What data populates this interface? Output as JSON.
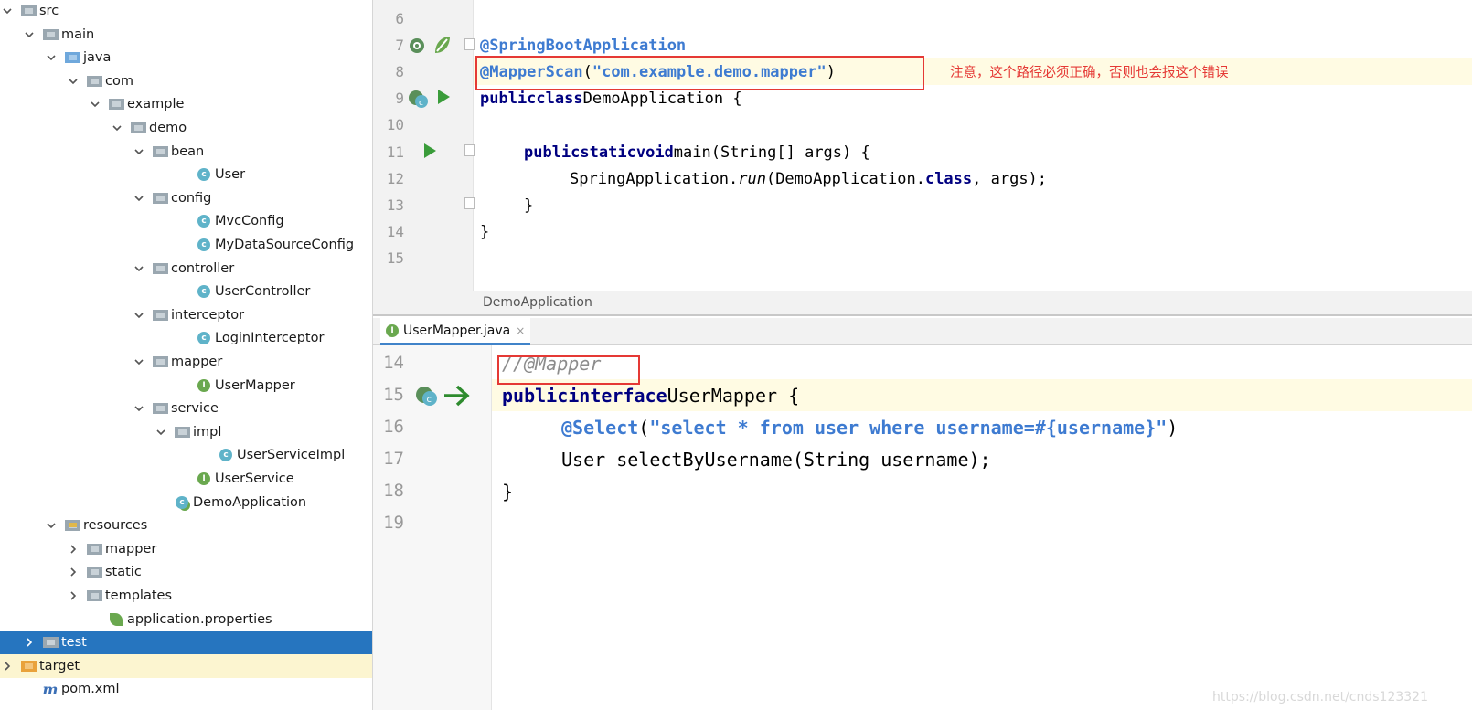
{
  "tree": {
    "items": [
      {
        "label": "src",
        "icon": "folder",
        "expanded": true
      },
      {
        "label": "main",
        "icon": "folder",
        "expanded": true
      },
      {
        "label": "java",
        "icon": "folder-blue",
        "expanded": true
      },
      {
        "label": "com",
        "icon": "package",
        "expanded": true
      },
      {
        "label": "example",
        "icon": "package",
        "expanded": true
      },
      {
        "label": "demo",
        "icon": "package",
        "expanded": true
      },
      {
        "label": "bean",
        "icon": "package",
        "expanded": true
      },
      {
        "label": "User",
        "icon": "class"
      },
      {
        "label": "config",
        "icon": "package",
        "expanded": true
      },
      {
        "label": "MvcConfig",
        "icon": "class"
      },
      {
        "label": "MyDataSourceConfig",
        "icon": "class"
      },
      {
        "label": "controller",
        "icon": "package",
        "expanded": true
      },
      {
        "label": "UserController",
        "icon": "class"
      },
      {
        "label": "interceptor",
        "icon": "package",
        "expanded": true
      },
      {
        "label": "LoginInterceptor",
        "icon": "class"
      },
      {
        "label": "mapper",
        "icon": "package",
        "expanded": true
      },
      {
        "label": "UserMapper",
        "icon": "interface"
      },
      {
        "label": "service",
        "icon": "package",
        "expanded": true
      },
      {
        "label": "impl",
        "icon": "package",
        "expanded": true
      },
      {
        "label": "UserServiceImpl",
        "icon": "class"
      },
      {
        "label": "UserService",
        "icon": "interface"
      },
      {
        "label": "DemoApplication",
        "icon": "spring-app-class"
      },
      {
        "label": "resources",
        "icon": "resources-folder",
        "expanded": true
      },
      {
        "label": "mapper",
        "icon": "folder",
        "expanded": false
      },
      {
        "label": "static",
        "icon": "folder",
        "expanded": false
      },
      {
        "label": "templates",
        "icon": "folder",
        "expanded": false
      },
      {
        "label": "application.properties",
        "icon": "spring-properties"
      },
      {
        "label": "test",
        "icon": "folder",
        "expanded": false,
        "selected": true
      },
      {
        "label": "target",
        "icon": "folder-orange",
        "expanded": false
      },
      {
        "label": "pom.xml",
        "icon": "maven"
      }
    ]
  },
  "editor_top": {
    "lines": [
      "6",
      "7",
      "8",
      "9",
      "10",
      "11",
      "12",
      "13",
      "14",
      "15"
    ],
    "annotation_boot": "@SpringBootApplication",
    "annotation_scan": "@MapperScan",
    "scan_open": "(",
    "scan_value": "\"com.example.demo.mapper\"",
    "scan_close": ")",
    "kw_public": "public",
    "kw_class": "class",
    "class_name": "DemoApplication {",
    "kw_static": "static",
    "kw_void": "void",
    "main_sig": "main(String[] args) {",
    "call_prefix": "SpringApplication.",
    "call_method": "run",
    "call_args_a": "(DemoApplication.",
    "call_kw_class": "class",
    "call_args_b": ", args);",
    "close_inner": "}",
    "close_outer": "}"
  },
  "note": "注意，这个路径必须正确，否则也会报这个错误",
  "breadcrumb": "DemoApplication",
  "tab": {
    "label": "UserMapper.java",
    "close": "×",
    "icon": "I"
  },
  "editor_bottom": {
    "lines": [
      "14",
      "15",
      "16",
      "17",
      "18",
      "19"
    ],
    "comment": "//@Mapper",
    "kw_public": "public",
    "kw_interface": "interface",
    "iface_name": "UserMapper {",
    "select_ann": "@Select",
    "select_open": "(",
    "select_sql": "\"select * from user where username=#{username}\"",
    "select_close": ")",
    "method_sig": "User selectByUsername(String username);",
    "close": "}"
  },
  "watermark": "https://blog.csdn.net/cnds123321",
  "colors": {
    "selection": "#2675bf",
    "annotation_box": "#e53935",
    "line_highlight": "#fffbe3"
  }
}
